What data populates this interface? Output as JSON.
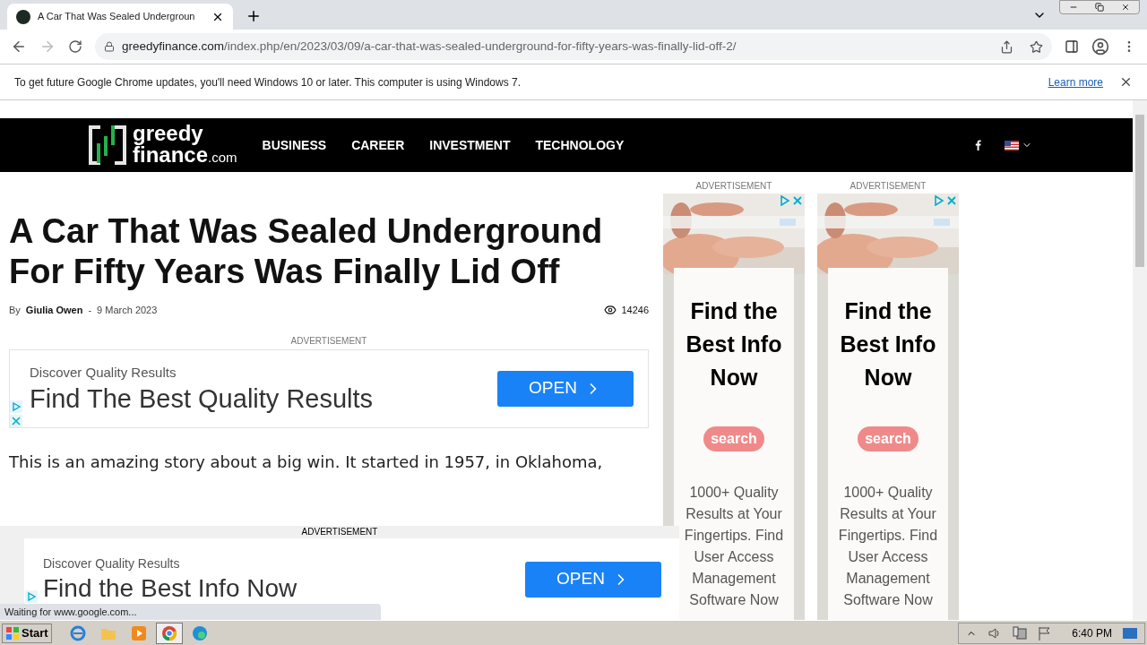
{
  "browser": {
    "tab": {
      "title": "A Car That Was Sealed Undergroun",
      "selected": true
    },
    "url": {
      "domain": "greedyfinance.com",
      "path": "/index.php/en/2023/03/09/a-car-that-was-sealed-underground-for-fifty-years-was-finally-lid-off-2/"
    },
    "infobar": {
      "message": "To get future Google Chrome updates, you'll need Windows 10 or later. This computer is using Windows 7.",
      "link": "Learn more"
    }
  },
  "site": {
    "logo": {
      "word1": "greedy",
      "word2": "finance",
      "tld": ".com"
    },
    "nav": [
      {
        "label": "BUSINESS"
      },
      {
        "label": "CAREER"
      },
      {
        "label": "INVESTMENT"
      },
      {
        "label": "TECHNOLOGY"
      }
    ]
  },
  "article": {
    "title": "A Car That Was Sealed Underground For Fifty Years Was Finally Lid Off",
    "byline": {
      "by": "By",
      "author": "Giulia Owen",
      "separator": "-",
      "date": "9 March 2023"
    },
    "views": "14246",
    "ad": {
      "label": "ADVERTISEMENT",
      "eyebrow": "Discover Quality Results",
      "headline": "Find The Best Quality Results",
      "button": "OPEN"
    },
    "paragraph": "This is an amazing story about a big win. It started in 1957, in Oklahoma,"
  },
  "side_ads": [
    {
      "label": "ADVERTISEMENT",
      "headline": "Find the Best Info Now",
      "logo": "search",
      "body": "1000+ Quality Results at Your Fingertips. Find User Access Management Software Now"
    },
    {
      "label": "ADVERTISEMENT",
      "headline": "Find the Best Info Now",
      "logo": "search",
      "body": "1000+ Quality Results at Your Fingertips. Find User Access Management Software Now"
    }
  ],
  "sticky_ad": {
    "label": "ADVERTISEMENT",
    "eyebrow": "Discover Quality Results",
    "headline": "Find the Best Info Now",
    "button": "OPEN"
  },
  "status_bubble": "Waiting for www.google.com...",
  "taskbar": {
    "start": "Start",
    "clock": "6:40 PM"
  }
}
